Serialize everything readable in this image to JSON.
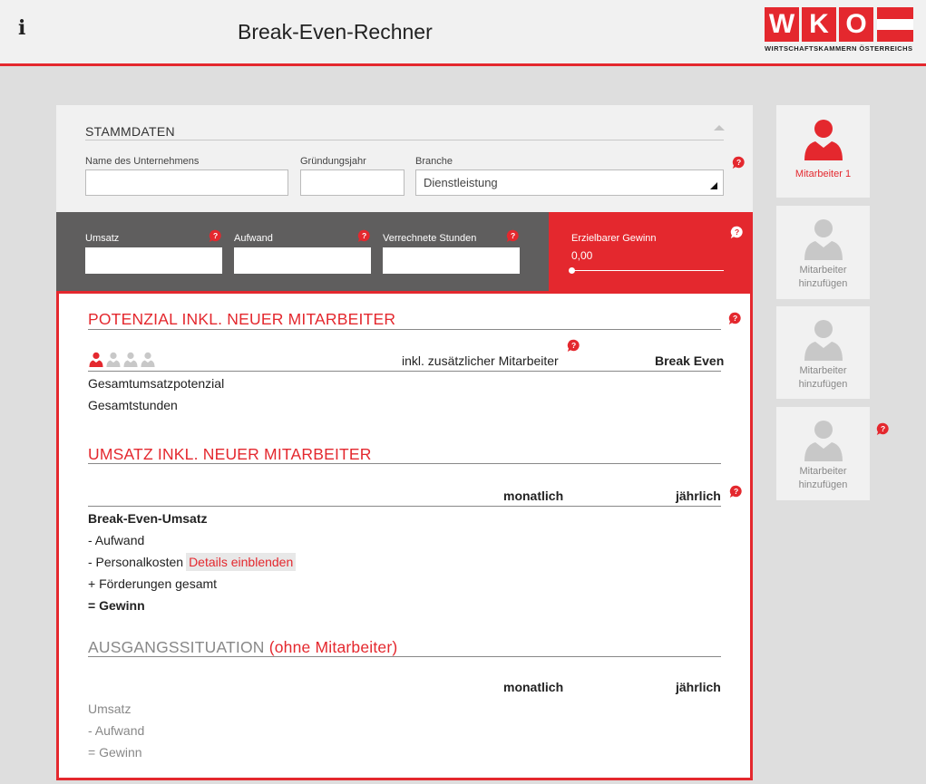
{
  "header": {
    "info_icon": "i",
    "title": "Break-Even-Rechner",
    "logo": {
      "letters": [
        "W",
        "K",
        "O"
      ],
      "subtitle": "WIRTSCHAFTSKAMMERN ÖSTERREICHS"
    }
  },
  "stammdaten": {
    "title": "STAMMDATEN",
    "company_label": "Name des Unternehmens",
    "company_value": "",
    "year_label": "Gründungsjahr",
    "year_value": "",
    "branch_label": "Branche",
    "branch_value": "Dienstleistung"
  },
  "inputs": {
    "umsatz_label": "Umsatz",
    "aufwand_label": "Aufwand",
    "stunden_label": "Verrechnete Stunden",
    "gewinn_label": "Erzielbarer Gewinn",
    "gewinn_value": "0,00",
    "gewinn_slider": 0
  },
  "potenzial": {
    "title": "POTENZIAL INKL. NEUER MITARBEITER",
    "col_mitarbeiter": "inkl. zusätzlicher Mitarbeiter",
    "col_break_even": "Break Even",
    "rows": [
      "Gesamtumsatzpotenzial",
      "Gesamtstunden"
    ],
    "employees_active": 1,
    "employees_total": 4
  },
  "umsatz": {
    "title": "UMSATZ INKL. NEUER MITARBEITER",
    "col_monthly": "monatlich",
    "col_yearly": "jährlich",
    "rows": {
      "break_even": "Break-Even-Umsatz",
      "aufwand": "- Aufwand",
      "personal": "- Personalkosten",
      "details": "Details einblenden",
      "foerderung": "+ Förderungen gesamt",
      "gewinn": "= Gewinn"
    }
  },
  "ausgang": {
    "title_main": "AUSGANGSSITUATION",
    "title_sub": "(ohne Mitarbeiter)",
    "col_monthly": "monatlich",
    "col_yearly": "jährlich",
    "rows": [
      "Umsatz",
      "- Aufwand",
      "= Gewinn"
    ]
  },
  "employees": [
    {
      "label_line1": "Mitarbeiter 1",
      "label_line2": ""
    },
    {
      "label_line1": "Mitarbeiter",
      "label_line2": "hinzufügen"
    },
    {
      "label_line1": "Mitarbeiter",
      "label_line2": "hinzufügen"
    },
    {
      "label_line1": "Mitarbeiter",
      "label_line2": "hinzufügen"
    }
  ],
  "colors": {
    "accent": "#e4282e",
    "dark_bar": "#5f5e5e",
    "background": "#dedede"
  },
  "icons": [
    "info-icon",
    "help-icon",
    "person-icon",
    "select-arrow-icon",
    "collapse-arrow-icon"
  ]
}
